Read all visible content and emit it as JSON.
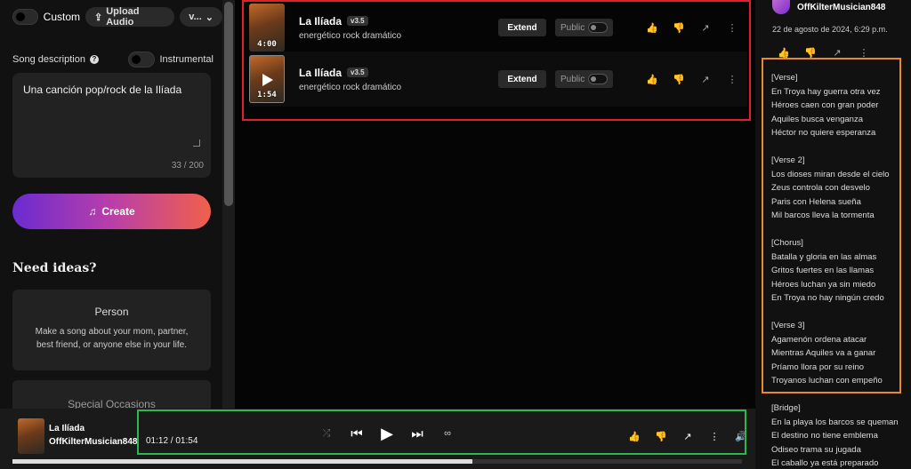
{
  "left": {
    "custom_label": "Custom",
    "upload_label": "Upload Audio",
    "version_label": "v...",
    "description_label": "Song description",
    "help_icon": "?",
    "instrumental_label": "Instrumental",
    "description_value": "Una canción pop/rock de la Ilíada",
    "char_count": "33 / 200",
    "create_label": "Create",
    "need_ideas": "Need ideas?",
    "cards": [
      {
        "title": "Person",
        "body": "Make a song about your mom, partner, best friend, or anyone else in your life."
      },
      {
        "title": "Special Occasions",
        "body": ""
      }
    ]
  },
  "songs": [
    {
      "title": "La Ilíada",
      "version": "v3.5",
      "style": "energético rock dramático",
      "duration": "4:00",
      "extend": "Extend",
      "public": "Public"
    },
    {
      "title": "La Ilíada",
      "version": "v3.5",
      "style": "energético rock dramático",
      "duration": "1:54",
      "extend": "Extend",
      "public": "Public"
    }
  ],
  "right": {
    "user": "OffKilterMusician848",
    "date": "22 de agosto de 2024, 6:29 p.m.",
    "lyrics": [
      "[Verse]",
      "En Troya hay guerra otra vez",
      "Héroes caen con gran poder",
      "Aquiles busca venganza",
      "Héctor no quiere esperanza",
      "",
      "[Verse 2]",
      "Los dioses miran desde el cielo",
      "Zeus controla con desvelo",
      "Paris con Helena sueña",
      "Mil barcos lleva la tormenta",
      "",
      "[Chorus]",
      "Batalla y gloria en las almas",
      "Gritos fuertes en las llamas",
      "Héroes luchan ya sin miedo",
      "En Troya no hay ningún credo",
      "",
      "[Verse 3]",
      "Agamenón ordena atacar",
      "Mientras Aquiles va a ganar",
      "Príamo llora por su reino",
      "Troyanos luchan con empeño",
      "",
      "[Bridge]",
      "En la playa los barcos se queman",
      "El destino no tiene emblema",
      "Odiseo trama su jugada",
      "El caballo ya está preparado"
    ]
  },
  "player": {
    "title": "La Ilíada",
    "artist": "OffKilterMusician848",
    "time": "01:12 / 01:54",
    "progress": 0.63
  },
  "colors": {
    "highlight_red": "#e0202a",
    "highlight_orange": "#e88a2a",
    "highlight_green": "#2cb84a"
  }
}
